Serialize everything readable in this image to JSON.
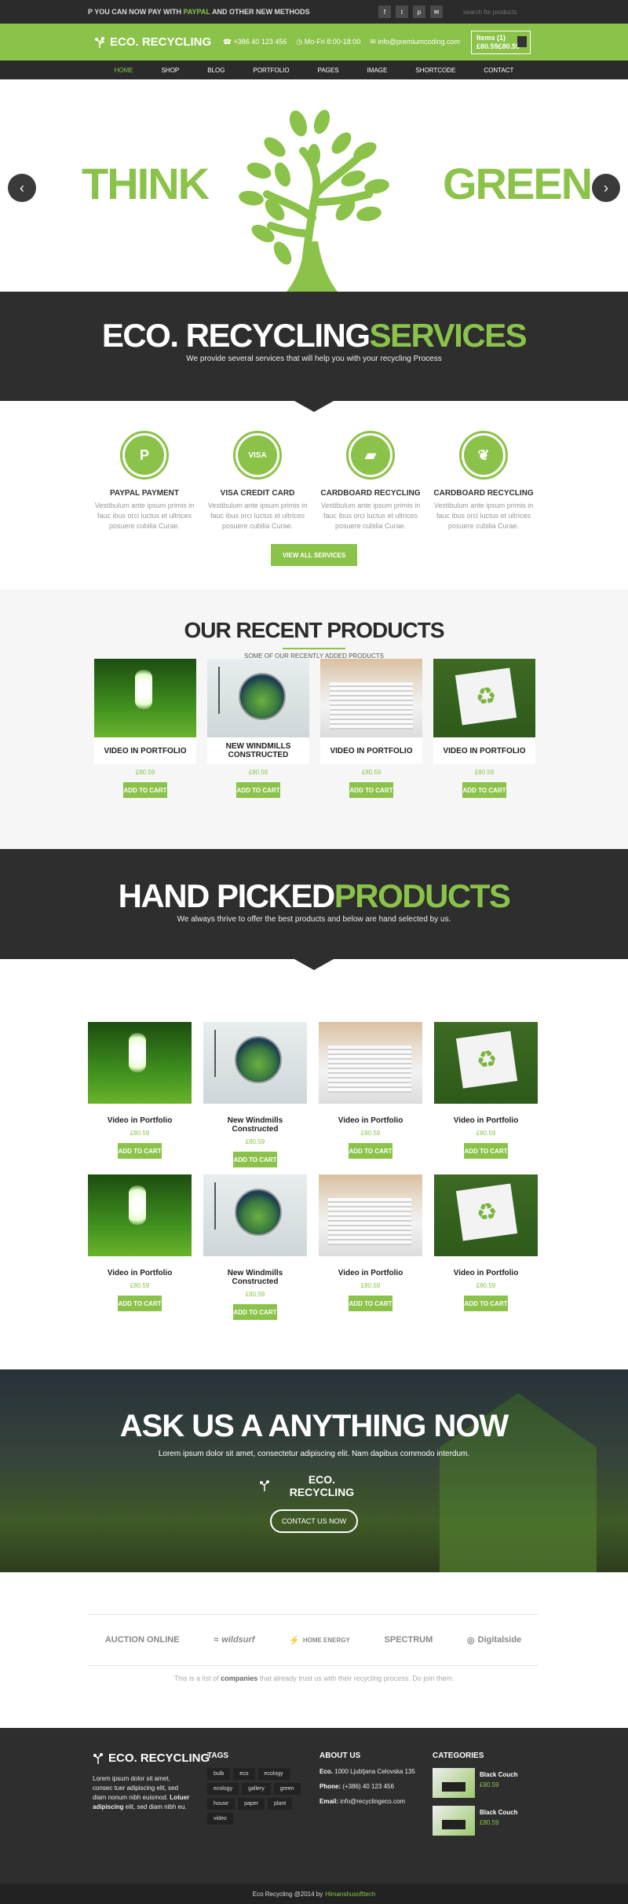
{
  "topbar": {
    "promo_prefix": "YOU CAN NOW PAY WITH",
    "promo_highlight": "PAYPAL",
    "promo_suffix": "AND OTHER NEW METHODS",
    "social_icons": [
      "facebook-icon",
      "twitter-icon",
      "pinterest-icon",
      "email-icon"
    ],
    "search_placeholder": "search for products"
  },
  "header": {
    "logo_text": "ECO. RECYCLING",
    "phone": "+386 40 123 456",
    "hours": "Mo-Fri 8:00-18:00",
    "email": "info@premiumcoding.com",
    "cart_items": "Items (1)",
    "cart_total": "£80.59£80.59"
  },
  "nav": {
    "items": [
      "HOME",
      "SHOP",
      "BLOG",
      "PORTFOLIO",
      "PAGES",
      "IMAGE",
      "SHORTCODE",
      "CONTACT"
    ],
    "active": "HOME"
  },
  "hero": {
    "left_word": "THINK",
    "right_word": "GREEN"
  },
  "services_band": {
    "title_main": "ECO. RECYCLING",
    "title_accent": "SERVICES",
    "subtitle": "We provide several services that will help you with your recycling Process"
  },
  "services": [
    {
      "title": "PAYPAL PAYMENT",
      "text": "Vestibulum ante ipsum primis in fauc ibus orci luctus et ultrices posuere cubilia Curae.",
      "icon": "paypal-icon"
    },
    {
      "title": "VISA CREDIT CARD",
      "text": "Vestibulum ante ipsum primis in fauc ibus orci luctus et ultrices posuere cubilia Curae.",
      "icon": "visa-icon"
    },
    {
      "title": "CARDBOARD RECYCLING",
      "text": "Vestibulum ante ipsum primis in fauc ibus orci luctus et ultrices posuere cubilia Curae.",
      "icon": "truck-icon"
    },
    {
      "title": "CARDBOARD RECYCLING",
      "text": "Vestibulum ante ipsum primis in fauc ibus orci luctus et ultrices posuere cubilia Curae.",
      "icon": "leaf-icon"
    }
  ],
  "services_button": "VIEW ALL SERVICES",
  "recent": {
    "title": "OUR RECENT PRODUCTS",
    "subtitle": "SOME OF OUR RECENTLY ADDED PRODUCTS",
    "products": [
      {
        "name": "VIDEO IN PORTFOLIO",
        "price": "£80.59",
        "button": "ADD TO CART"
      },
      {
        "name": "NEW WINDMILLS CONSTRUCTED",
        "price": "£80.59",
        "button": "ADD TO CART"
      },
      {
        "name": "VIDEO IN PORTFOLIO",
        "price": "£80.59",
        "button": "ADD TO CART"
      },
      {
        "name": "VIDEO IN PORTFOLIO",
        "price": "£80.59",
        "button": "ADD TO CART"
      }
    ]
  },
  "handpicked_band": {
    "title_main": "HAND PICKED",
    "title_accent": "PRODUCTS",
    "subtitle": "We always thrive to offer the best products and below are hand selected by us."
  },
  "handpicked": [
    {
      "name": "Video in Portfolio",
      "price": "£80.59",
      "button": "ADD TO CART"
    },
    {
      "name": "New Windmills Constructed",
      "price": "£80.59",
      "button": "ADD TO CART"
    },
    {
      "name": "Video in Portfolio",
      "price": "£80.59",
      "button": "ADD TO CART"
    },
    {
      "name": "Video in Portfolio",
      "price": "£80.59",
      "button": "ADD TO CART"
    },
    {
      "name": "Video in Portfolio",
      "price": "£80.59",
      "button": "ADD TO CART"
    },
    {
      "name": "New Windmills Constructed",
      "price": "£80.59",
      "button": "ADD TO CART"
    },
    {
      "name": "Video in Portfolio",
      "price": "£80.59",
      "button": "ADD TO CART"
    },
    {
      "name": "Video in Portfolio",
      "price": "£80.59",
      "button": "ADD TO CART"
    }
  ],
  "ask": {
    "title": "ASK US A ANYTHING NOW",
    "subtitle": "Lorem ipsum dolor sit amet, consectetur adipiscing elit. Nam dapibus commodo interdum.",
    "logo_text": "ECO. RECYCLING",
    "button": "CONTACT US NOW"
  },
  "partners": {
    "logos": [
      "AUCTION ONLINE",
      "wildsurf",
      "HOME ENERGY",
      "SPECTRUM",
      "Digitalside"
    ],
    "note_prefix": "This is a list of",
    "note_bold": "companies",
    "note_suffix": "that already trust us with their recycling process. Do join them."
  },
  "footer": {
    "logo_text": "ECO. RECYCLING",
    "about_1": "Lorem ipsum dolor sit amet, consec tuer adipiscing elit, sed diam nonum nibh euismod.",
    "about_bold": "Lotuer adipiscing",
    "about_2": "elit, sed diam nibh eu.",
    "tags_title": "TAGS",
    "tags": [
      "bulb",
      "eco",
      "ecology",
      "ecology",
      "gallery",
      "green",
      "house",
      "paper",
      "plant",
      "video"
    ],
    "about_title": "ABOUT US",
    "address_label": "Eco.",
    "address": "1000 Ljubljana Celovska 135",
    "phone_label": "Phone:",
    "phone": "(+386) 40 123 456",
    "email_label": "Email:",
    "email": "info@recyclingeco.com",
    "categories_title": "CATEGORIES",
    "categories": [
      {
        "name": "Black Couch",
        "price": "£80.59"
      },
      {
        "name": "Black Couch",
        "price": "£80.59"
      }
    ],
    "copyright": "Eco Recycling @2014 by",
    "copyright_link": "Himanshusofttech"
  },
  "colors": {
    "accent": "#8bc34a",
    "dark": "#2e2e2e"
  }
}
